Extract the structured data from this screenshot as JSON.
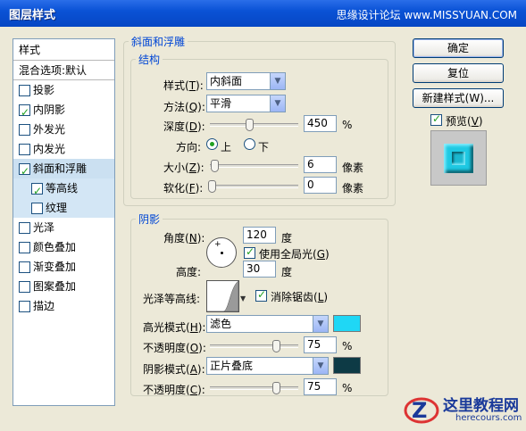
{
  "window": {
    "title": "图层样式",
    "tb_right": "",
    "watermark": "思缘设计论坛 www.MISSYUAN.COM"
  },
  "sidebar": {
    "header": "样式",
    "blend": "混合选项:默认",
    "items": [
      {
        "label": "投影",
        "checked": false
      },
      {
        "label": "内阴影",
        "checked": true
      },
      {
        "label": "外发光",
        "checked": false
      },
      {
        "label": "内发光",
        "checked": false
      },
      {
        "label": "斜面和浮雕",
        "checked": true
      },
      {
        "label": "等高线",
        "checked": true
      },
      {
        "label": "纹理",
        "checked": false
      },
      {
        "label": "光泽",
        "checked": false
      },
      {
        "label": "颜色叠加",
        "checked": false
      },
      {
        "label": "渐变叠加",
        "checked": false
      },
      {
        "label": "图案叠加",
        "checked": false
      },
      {
        "label": "描边",
        "checked": false
      }
    ]
  },
  "bevel": {
    "group_title": "斜面和浮雕",
    "structure_title": "结构",
    "style_label": "样式",
    "style_key": "T",
    "style_value": "内斜面",
    "technique_label": "方法",
    "technique_key": "Q",
    "technique_value": "平滑",
    "depth_label": "深度",
    "depth_key": "D",
    "depth_value": "450",
    "depth_unit": "%",
    "direction_label": "方向:",
    "direction_up": "上",
    "direction_down": "下",
    "size_label": "大小",
    "size_key": "Z",
    "size_value": "6",
    "size_unit": "像素",
    "soften_label": "软化",
    "soften_key": "F",
    "soften_value": "0",
    "soften_unit": "像素"
  },
  "shading": {
    "title": "阴影",
    "angle_label": "角度",
    "angle_key": "N",
    "angle_value": "120",
    "angle_unit": "度",
    "global_light_label": "使用全局光",
    "global_light_key": "G",
    "altitude_label": "高度:",
    "altitude_value": "30",
    "altitude_unit": "度",
    "gloss_contour_label": "光泽等高线:",
    "antialias_label": "消除锯齿",
    "antialias_key": "L",
    "highlight_mode_label": "高光模式",
    "highlight_mode_key": "H",
    "highlight_mode_value": "滤色",
    "highlight_color": "#1fd7f5",
    "highlight_opacity_label": "不透明度",
    "highlight_opacity_key": "O",
    "highlight_opacity_value": "75",
    "opacity_unit": "%",
    "shadow_mode_label": "阴影模式",
    "shadow_mode_key": "A",
    "shadow_mode_value": "正片叠底",
    "shadow_color": "#0d3a45",
    "shadow_opacity_label": "不透明度",
    "shadow_opacity_key": "C",
    "shadow_opacity_value": "75"
  },
  "buttons": {
    "ok": "确定",
    "reset": "复位",
    "new_style": "新建样式(W)...",
    "preview_label": "预览",
    "preview_key": "V"
  },
  "logo": {
    "cn": "这里教程网",
    "en": "herecours.com"
  }
}
